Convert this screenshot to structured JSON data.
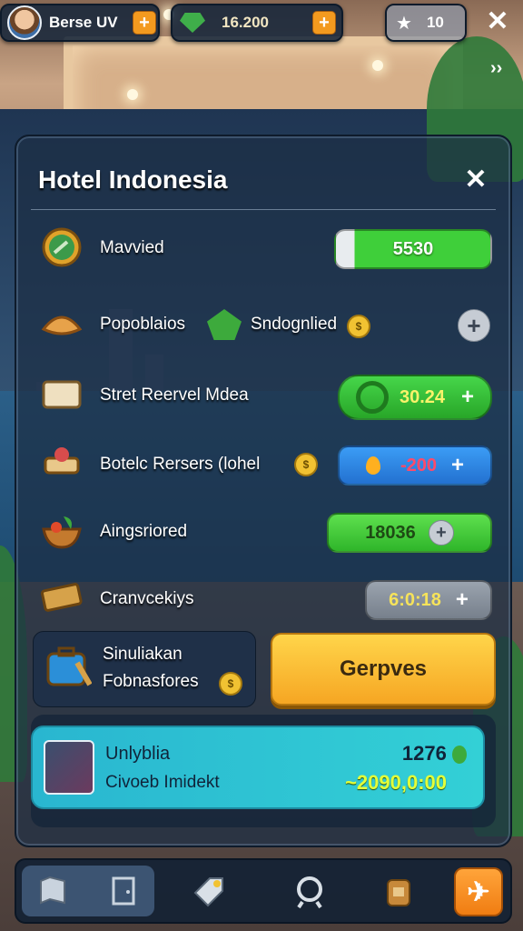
{
  "topbar": {
    "player_name": "Berse UV",
    "currency": "16.200",
    "stars": "10"
  },
  "panel": {
    "title": "Hotel Indonesia",
    "rows": [
      {
        "label": "Mavvied",
        "value": "5530",
        "bar_fill": 0.85,
        "icon": "globe-icon"
      },
      {
        "label": "Popoblaios",
        "label2": "Sndognlied",
        "icon": "croissant-icon"
      },
      {
        "label": "Stret Reervel Mdea",
        "value": "30.24",
        "icon": "towel-icon"
      },
      {
        "label": "Botelc Rersers (lohel",
        "value": "-200",
        "icon": "room-service-icon"
      },
      {
        "label": "Aingsriored",
        "value": "18036",
        "icon": "food-bowl-icon"
      },
      {
        "label": "Cranvcekiys",
        "value": "6:0:18",
        "icon": "ticket-icon"
      }
    ],
    "sim": {
      "line1": "Sinuliakan",
      "line2": "Fobnasfores",
      "icon": "luggage-icon"
    },
    "action_button": "Gerpves",
    "offer": {
      "title": "Unlyblia",
      "subtitle": "Civoeb Imidekt",
      "amount": "1276",
      "price": "~2090,0:00",
      "icon": "map-icon"
    }
  },
  "colors": {
    "green": "#3fcf3a",
    "blue": "#2f86e6",
    "gold": "#ffd54a",
    "accent_orange": "#f39a1f"
  }
}
